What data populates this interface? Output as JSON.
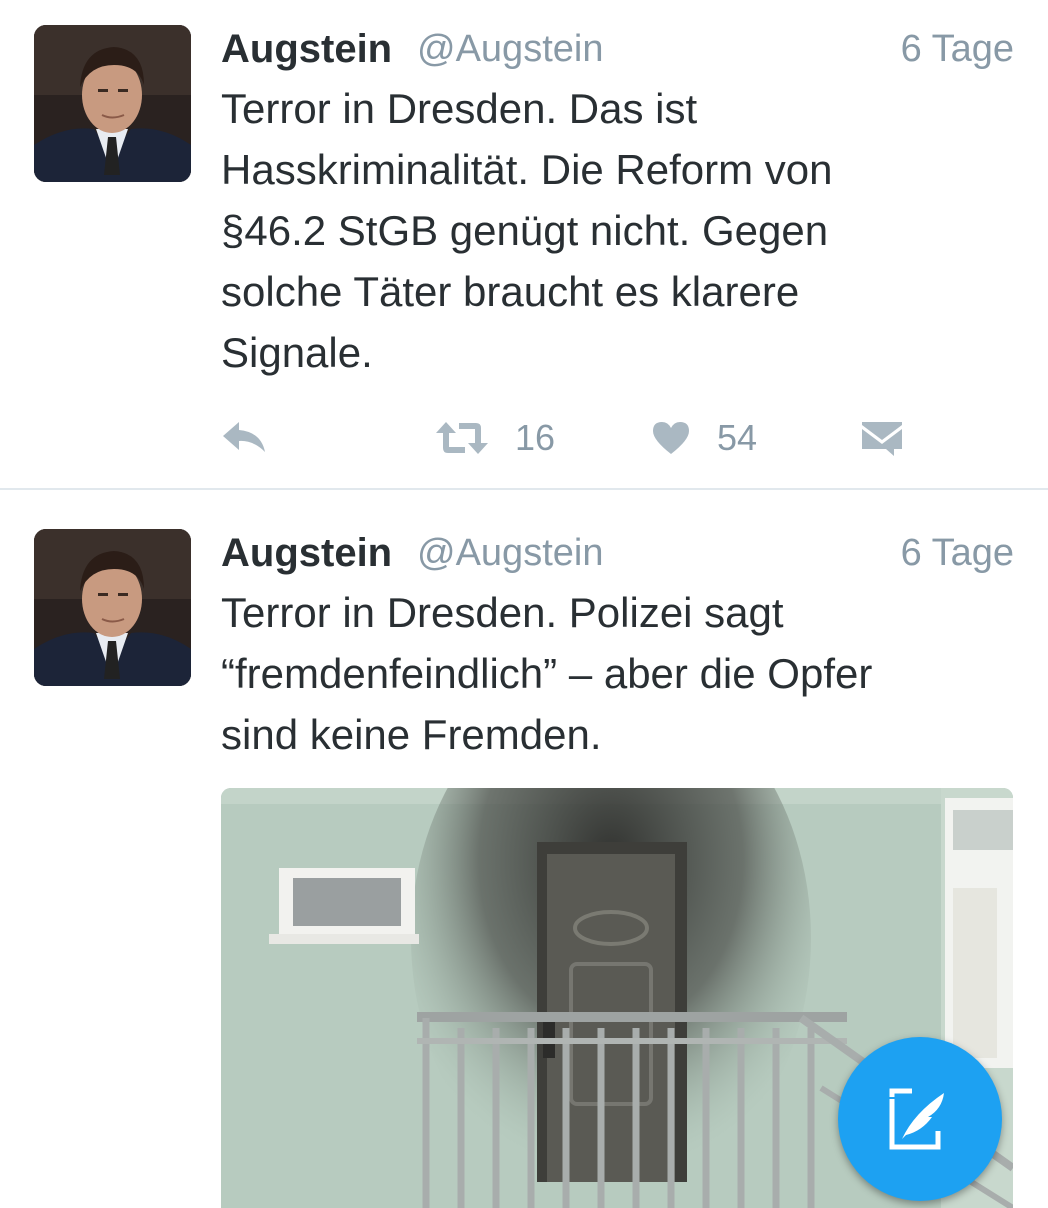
{
  "tweets": [
    {
      "author": "Augstein",
      "handle": "@Augstein",
      "time": "6 Tage",
      "text_lines": [
        "Terror in Dresden. Das ist",
        "Hasskriminalität. Die Reform von",
        "§46.2 StGB genügt nicht. Gegen",
        "solche Täter braucht es klarere",
        "Signale."
      ],
      "actions": {
        "retweets": "16",
        "likes": "54"
      }
    },
    {
      "author": "Augstein",
      "handle": "@Augstein",
      "time": "6 Tage",
      "text_lines": [
        "Terror in Dresden. Polizei sagt",
        "“fremdenfeindlich” – aber die Opfer",
        "sind keine Fremden."
      ]
    }
  ],
  "icons": {
    "reply": "reply-icon",
    "retweet": "retweet-icon",
    "like": "heart-icon",
    "dm": "direct-message-icon",
    "compose": "compose-tweet-icon"
  },
  "colors": {
    "accent": "#1da1f2",
    "muted": "#8899a6",
    "icon": "#aab8c2",
    "text": "#292f33"
  }
}
